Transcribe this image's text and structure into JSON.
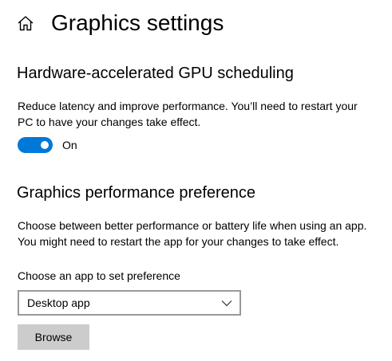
{
  "header": {
    "home_icon": "home-icon",
    "title": "Graphics settings"
  },
  "gpu_scheduling": {
    "heading": "Hardware-accelerated GPU scheduling",
    "description_lines": [
      "Reduce latency and improve performance. You’ll need to restart your",
      "PC to have your changes take effect."
    ],
    "toggle_state": "on",
    "toggle_label": "On"
  },
  "performance_preference": {
    "heading": "Graphics performance preference",
    "description_lines": [
      "Choose between better performance or battery life when using an app.",
      "You might need to restart the app for your changes to take effect."
    ],
    "app_picker_label": "Choose an app to set preference",
    "app_picker_value": "Desktop app",
    "browse_button": "Browse"
  },
  "colors": {
    "accent": "#0078d7",
    "button_bg": "#cccccc",
    "dropdown_border": "#999999"
  }
}
